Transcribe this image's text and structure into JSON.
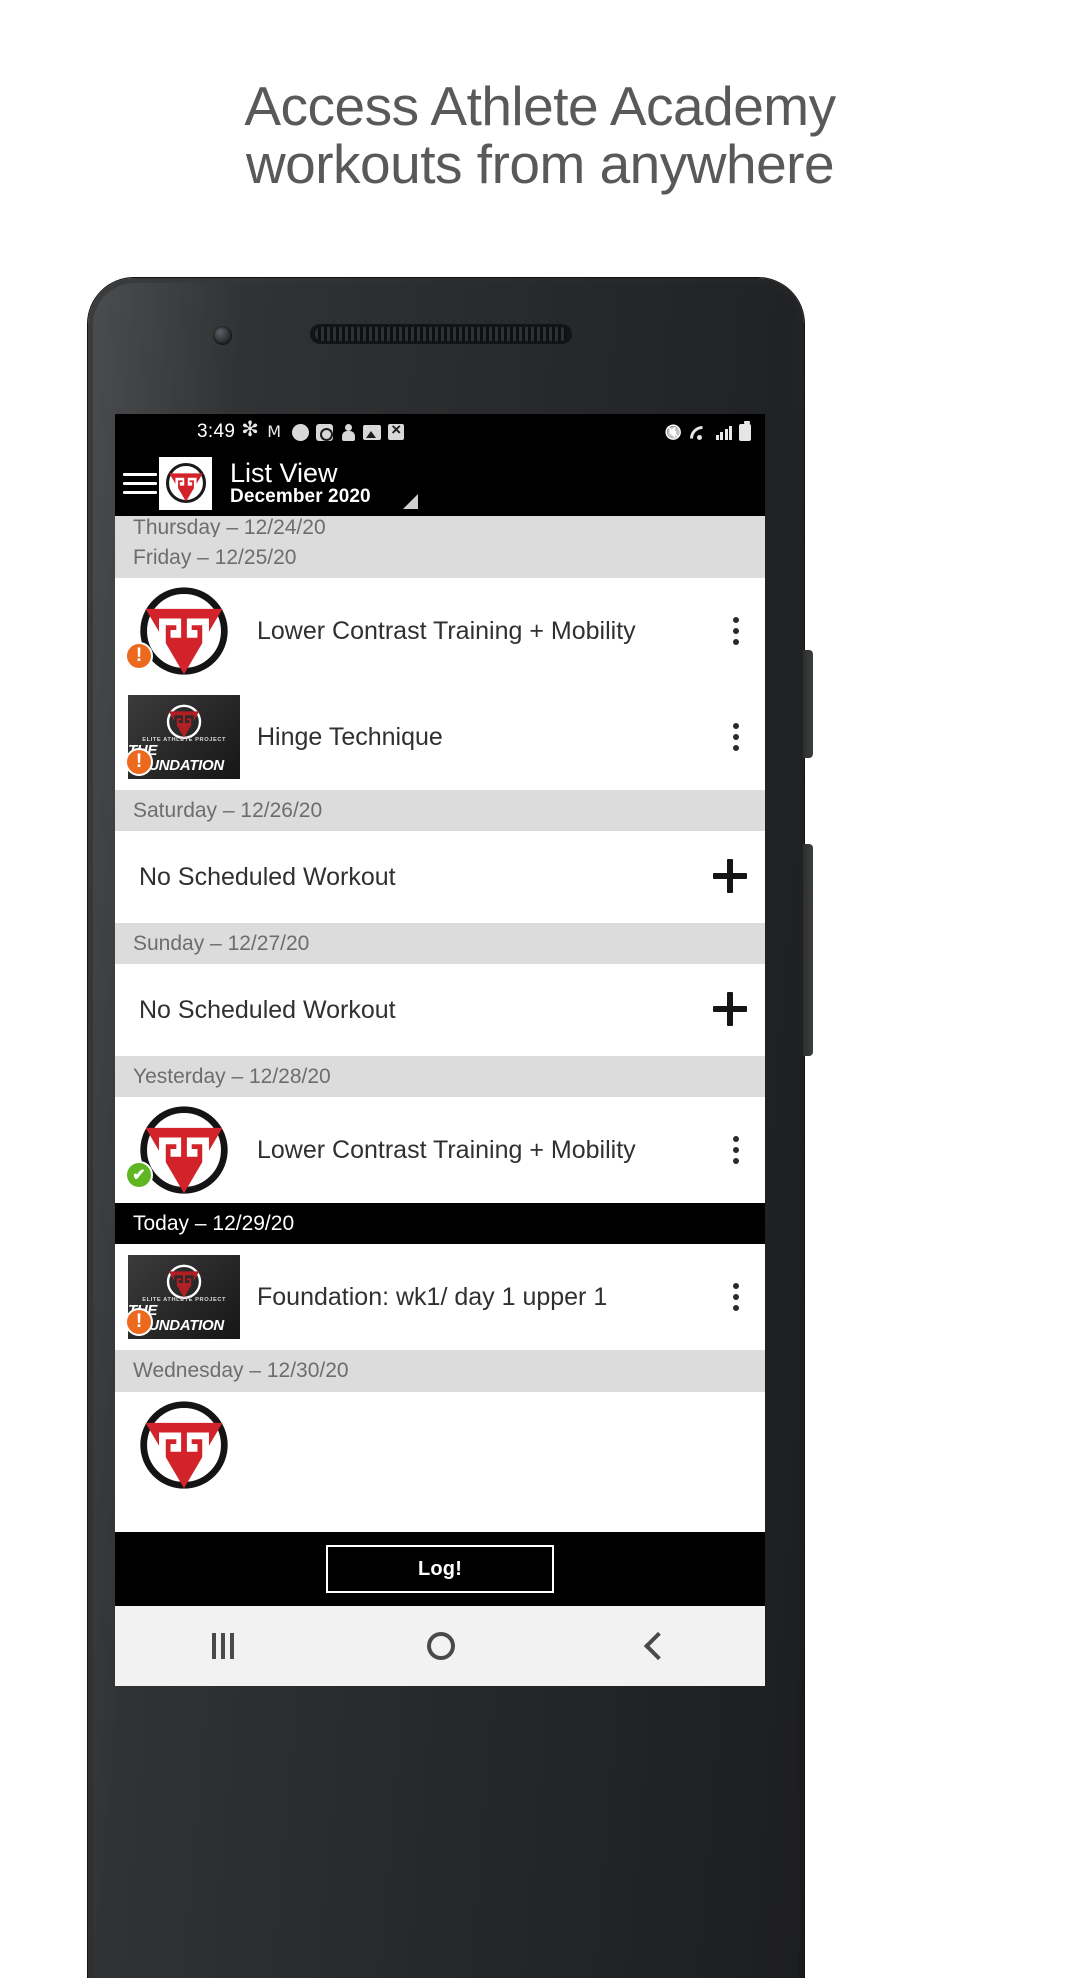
{
  "headline": {
    "line1": "Access Athlete Academy",
    "line2": "workouts from anywhere"
  },
  "statusbar": {
    "time": "3:49",
    "left_icons": [
      "slack-icon",
      "gmail-icon",
      "circle-icon",
      "clock-icon",
      "person-icon",
      "photo-icon",
      "close-icon"
    ],
    "right_icons": [
      "mute-icon",
      "wifi-icon",
      "signal-icon",
      "battery-icon"
    ]
  },
  "appbar": {
    "menu_icon": "hamburger-icon",
    "logo": "athlete-academy-logo",
    "title": "List View",
    "subtitle": "December 2020",
    "dropdown_icon": "triangle-dropdown-icon"
  },
  "thumb_foundation": {
    "sub": "ELITE ATHLETE PROJECT",
    "main": "THE FOUNDATION"
  },
  "list": [
    {
      "type": "day",
      "label": "Thursday  –  12/24/20",
      "today": false,
      "clipped": true
    },
    {
      "type": "day",
      "label": "Friday  –  12/25/20",
      "today": false,
      "clipped": false
    },
    {
      "type": "workout",
      "title": "Lower Contrast Training + Mobility",
      "thumb": "aa-logo",
      "badge": "warn",
      "action": "kebab"
    },
    {
      "type": "workout",
      "title": "Hinge Technique",
      "thumb": "foundation",
      "badge": "warn",
      "action": "kebab"
    },
    {
      "type": "day",
      "label": "Saturday  –  12/26/20",
      "today": false,
      "clipped": false
    },
    {
      "type": "empty",
      "title": "No Scheduled Workout",
      "action": "plus"
    },
    {
      "type": "day",
      "label": "Sunday  –  12/27/20",
      "today": false,
      "clipped": false
    },
    {
      "type": "empty",
      "title": "No Scheduled Workout",
      "action": "plus"
    },
    {
      "type": "day",
      "label": "Yesterday  –  12/28/20",
      "today": false,
      "clipped": false
    },
    {
      "type": "workout",
      "title": "Lower Contrast Training + Mobility",
      "thumb": "aa-logo",
      "badge": "done",
      "action": "kebab"
    },
    {
      "type": "day",
      "label": "Today  –  12/29/20",
      "today": true,
      "clipped": false
    },
    {
      "type": "workout",
      "title": "Foundation: wk1/ day 1 upper 1",
      "thumb": "foundation",
      "badge": "warn",
      "action": "kebab"
    },
    {
      "type": "day",
      "label": "Wednesday  –  12/30/20",
      "today": false,
      "clipped": false
    },
    {
      "type": "workout",
      "title": "",
      "thumb": "aa-logo",
      "badge": "none",
      "action": "none"
    }
  ],
  "bottom": {
    "log_label": "Log!"
  },
  "navbar": {
    "recent": "recent-apps-icon",
    "home": "home-icon",
    "back": "back-icon"
  },
  "colors": {
    "brand_red": "#d2232a",
    "warn_orange": "#ec6a1e",
    "done_green": "#5fb522",
    "day_header_bg": "#dcdcdc",
    "today_bg": "#000000"
  }
}
